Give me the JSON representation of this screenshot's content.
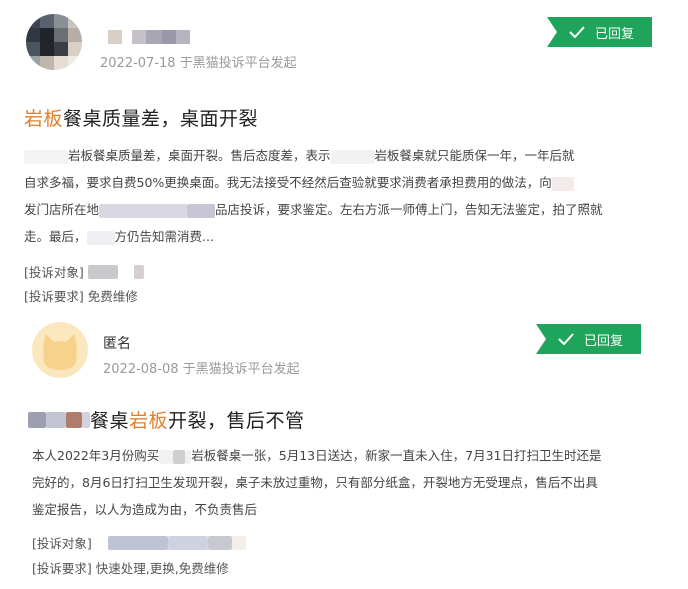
{
  "complaints": [
    {
      "date_line": "2022-07-18 于黑猫投诉平台发起",
      "status": "已回复",
      "title_hl": "岩板",
      "title_rest": "餐桌质量差，桌面开裂",
      "body": {
        "l1": "岩板餐桌质量差，桌面开裂。售后态度差，表示",
        "l1b": "岩板餐桌就只能质保一年，一年后就",
        "l2": "自求多福，要求自费50%更换桌面。我无法接受不经然后查验就要求消费者承担费用的做法，向",
        "l3a": "发门店所在地",
        "l3b": "品店投诉，要求鉴定。左右方派一师傅上门，告知无法鉴定，拍了照就",
        "l4a": "走。最后，",
        "l4b": "方仍告知需消费..."
      },
      "target_label": "[投诉对象]",
      "request_label": "[投诉要求]",
      "request_value": "免费维修"
    },
    {
      "name": "匿名",
      "date_line": "2022-08-08 于黑猫投诉平台发起",
      "status": "已回复",
      "title_pre": "餐桌",
      "title_hl": "岩板",
      "title_rest": "开裂，售后不管",
      "body": {
        "l1a": "本人2022年3月份购买",
        "l1b": "岩板餐桌一张，5月13日送达，新家一直未入住，7月31日打扫卫生时还是",
        "l2": "完好的，8月6日打扫卫生发现开裂，桌子未放过重物，只有部分纸盒，开裂地方无受理点，售后不出具",
        "l3": "鉴定报告，以人为造成为由，不负责售后"
      },
      "target_label": "[投诉对象]",
      "request_label": "[投诉要求]",
      "request_value": "快速处理,更换,免费维修"
    }
  ],
  "colors": {
    "badge": "#1fa55b",
    "highlight": "#e1802c"
  },
  "icons": [
    "check-icon",
    "cat-avatar-icon"
  ]
}
